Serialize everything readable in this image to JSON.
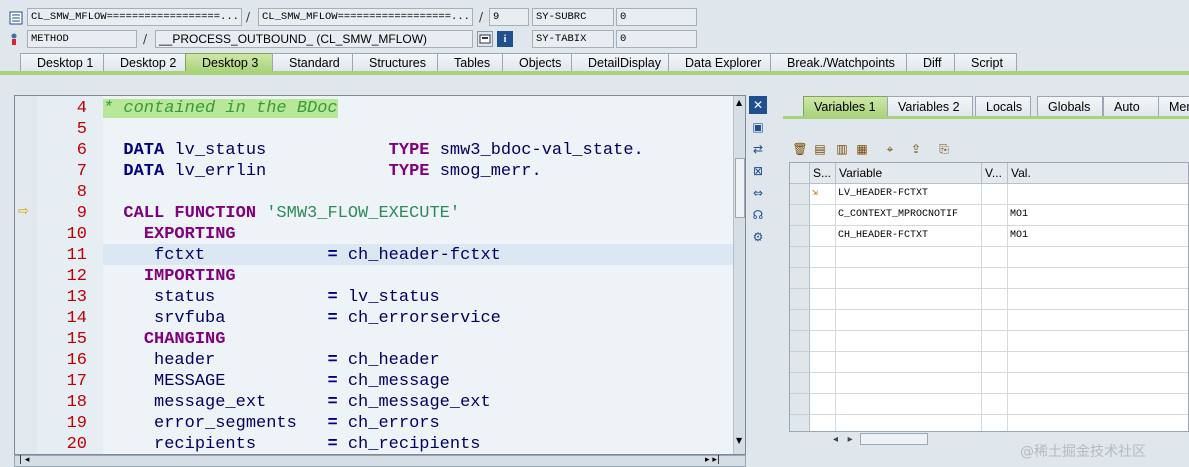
{
  "header": {
    "row1": {
      "program": "CL_SMW_MFLOW==================...",
      "include": "CL_SMW_MFLOW==================...",
      "line": "9",
      "var1_name": "SY-SUBRC",
      "var1_value": "0"
    },
    "row2": {
      "event_type": "METHOD",
      "event_name": "__PROCESS_OUTBOUND_ (CL_SMW_MFLOW)",
      "var2_name": "SY-TABIX",
      "var2_value": "0"
    },
    "separator": "/"
  },
  "tabs": [
    "Desktop 1",
    "Desktop 2",
    "Desktop 3",
    "Standard",
    "Structures",
    "Tables",
    "Objects",
    "DetailDisplay",
    "Data Explorer",
    "Break./Watchpoints",
    "Diff",
    "Script"
  ],
  "active_tab": "Desktop 3",
  "code": {
    "lines": [
      {
        "num": "4",
        "text": "* contained in the BDoc"
      },
      {
        "num": "5",
        "text": ""
      },
      {
        "num": "6",
        "kw": "DATA",
        "var": "lv_status",
        "type_kw": "TYPE",
        "type": "smw3_bdoc-val_state."
      },
      {
        "num": "7",
        "kw": "DATA",
        "var": "lv_errlin",
        "type_kw": "TYPE",
        "type": "smog_merr."
      },
      {
        "num": "8",
        "text": ""
      },
      {
        "num": "9",
        "kw": "CALL FUNCTION",
        "str": "'SMW3_FLOW_EXECUTE'"
      },
      {
        "num": "10",
        "kw2": "EXPORTING"
      },
      {
        "num": "11",
        "param": "fctxt",
        "value": "ch_header-fctxt"
      },
      {
        "num": "12",
        "kw2": "IMPORTING"
      },
      {
        "num": "13",
        "param": "status",
        "value": "lv_status"
      },
      {
        "num": "14",
        "param": "srvfuba",
        "value": "ch_errorservice"
      },
      {
        "num": "15",
        "kw2": "CHANGING"
      },
      {
        "num": "16",
        "param": "header",
        "value": "ch_header"
      },
      {
        "num": "17",
        "param": "MESSAGE",
        "value": "ch_message"
      },
      {
        "num": "18",
        "param": "message_ext",
        "value": "ch_message_ext"
      },
      {
        "num": "19",
        "param": "error_segments",
        "value": "ch_errors"
      },
      {
        "num": "20",
        "param": "recipients",
        "value": "ch_recipients"
      }
    ],
    "equals": "="
  },
  "right_tabs": [
    "Variables 1",
    "Variables 2",
    "Locals",
    "Globals",
    "Auto",
    "Mer"
  ],
  "right_active_tab": "Variables 1",
  "grid": {
    "headers": [
      "S...",
      "Variable",
      "V...",
      "Val."
    ],
    "rows": [
      {
        "variable": "LV_HEADER-FCTXT",
        "value": ""
      },
      {
        "variable": "C_CONTEXT_MPROCNOTIF",
        "value": "MO1"
      },
      {
        "variable": "CH_HEADER-FCTXT",
        "value": "MO1"
      }
    ]
  },
  "watermark": "@稀土掘金技术社区"
}
